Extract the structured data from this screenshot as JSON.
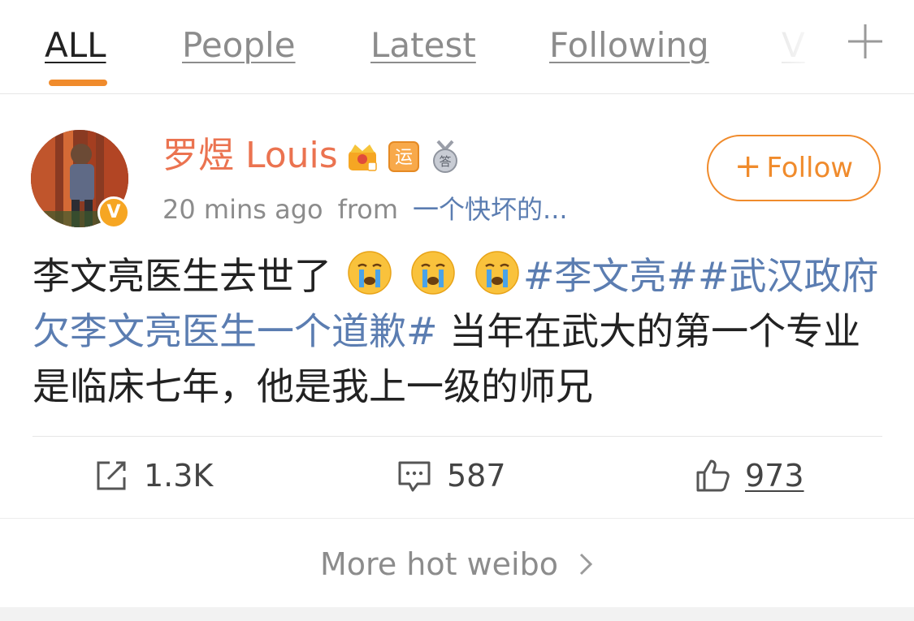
{
  "tabs": [
    {
      "label": "ALL",
      "active": true
    },
    {
      "label": "People",
      "active": false
    },
    {
      "label": "Latest",
      "active": false
    },
    {
      "label": "Following",
      "active": false
    },
    {
      "label": "V",
      "active": false
    }
  ],
  "post": {
    "username": "罗煜 Louis",
    "time": "20 mins ago",
    "from_label": "from",
    "source": "一个快坏的...",
    "follow_label": "Follow",
    "verified_badge": "V",
    "text": {
      "part1": "李文亮医生去世了",
      "topic1": "#李文亮#",
      "topic2": "#武汉政府欠李文亮医生一个道歉#",
      "part2": " 当年在武大的第一个专业是临床七年，他是我上一级的师兄"
    },
    "emoji_names": [
      "crying-face-icon",
      "crying-face-icon",
      "crying-face-icon"
    ],
    "badges": [
      "crown-icon",
      "yun-badge-icon",
      "medal-icon"
    ],
    "badge_text": {
      "yun": "运",
      "medal": "答"
    },
    "stats": {
      "reposts": "1.3K",
      "comments": "587",
      "likes": "973"
    }
  },
  "more_link": "More hot weibo",
  "colors": {
    "accent": "#f08b2c",
    "username": "#eb7350",
    "topic": "#5b7db1",
    "muted": "#8c8c8c"
  }
}
